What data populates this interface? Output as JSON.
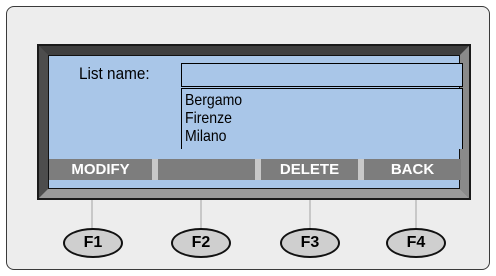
{
  "screen": {
    "list_name_label": "List name:",
    "list_name_value": "",
    "list_items": [
      "Bergamo",
      "Firenze",
      "Milano"
    ]
  },
  "softkeys": [
    "MODIFY",
    "",
    "DELETE",
    "BACK"
  ],
  "function_keys": [
    "F1",
    "F2",
    "F3",
    "F4"
  ],
  "colors": {
    "screen_background": "#a9c6e8",
    "softkey_background": "#7d7d7d",
    "device_background": "#ededed",
    "key_background": "#cfcfcf"
  }
}
